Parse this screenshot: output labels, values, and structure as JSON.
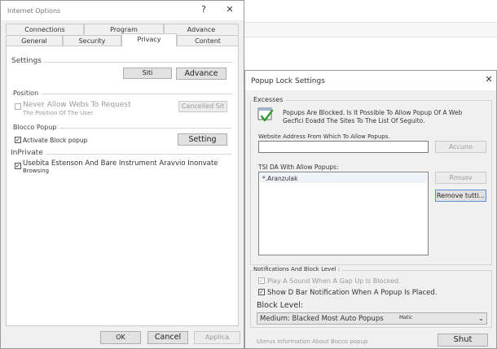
{
  "internet_options": {
    "title": "Internet Options",
    "help": "?",
    "close": "✕",
    "tabs_top": [
      "Connections",
      "Program",
      "Advance"
    ],
    "tabs_bottom": [
      "General",
      "Security",
      "Privacy",
      "Content"
    ],
    "settings": {
      "heading": "Settings",
      "sites_button": "Siti",
      "advanced_button": "Advance"
    },
    "position": {
      "heading": "Position",
      "checkbox_label": "Never Allow Webs To Request",
      "checkbox_sublabel": "The Position Of The User",
      "clear_button": "Cancelled Sit"
    },
    "popup_block": {
      "heading": "Blocco Popup",
      "checkbox_label": "Activate Block popup",
      "settings_button": "Setting"
    },
    "inprivate": {
      "heading": "InPrivate",
      "checkbox_label": "Usebita Estenson And Bare Instrument Aravvio Inonvate",
      "checkbox_sublabel": "Browsing"
    },
    "footer": {
      "ok": "OK",
      "cancel": "Cancel",
      "apply": "Applica"
    }
  },
  "popup_settings": {
    "title": "Popup Lock Settings",
    "close": "✕",
    "exceptions": {
      "heading": "Excesses",
      "info_line1": "Popups Are Blocked. Is It Possible To Allow Popup Of A Web",
      "info_line2": "Gecfici Eoadd The Sites To The List Of Seguito.",
      "address_label": "Website Address From Which To Allow Popups.",
      "address_value": "",
      "add_button": "Accuno",
      "list_label": "TSI DA With Allow Popups:",
      "list_items": [
        "*.Aranzulak"
      ],
      "remove_button": "Rmuov",
      "remove_all_button": "Remove tutti..."
    },
    "notifications": {
      "heading": "Notifications And Block Level :",
      "play_sound_label": "Play A Sound When A Gap Up Is Blocked.",
      "play_sound_checked": true,
      "show_bar_label": "Show D Bar Notification When A Popup Is Placed.",
      "show_bar_checked": true,
      "block_level_label": "Block Level:",
      "block_level_value": "Medium: Blacked Most Auto Popups",
      "block_level_suffix": "Matic"
    },
    "footer": {
      "info_link": "Uterus Information About Bocco popup",
      "close_button": "Shut"
    }
  }
}
